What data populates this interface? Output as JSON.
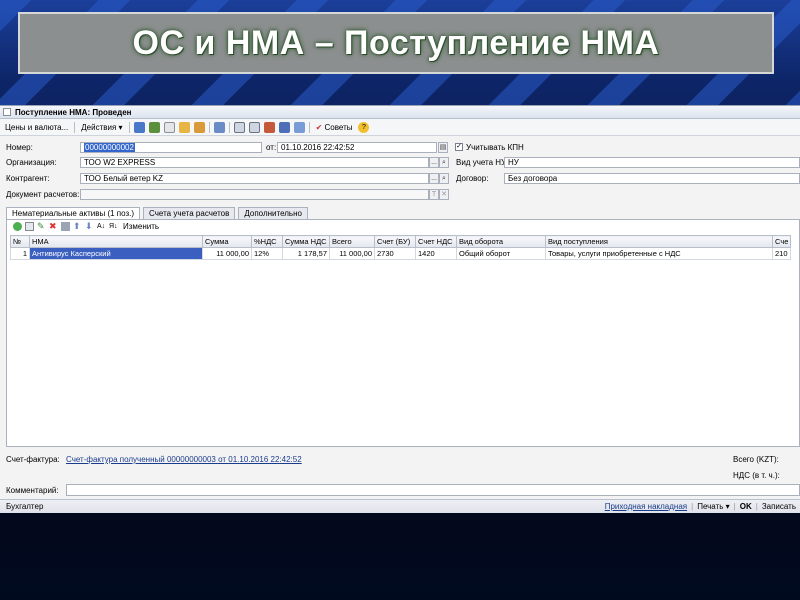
{
  "slide": {
    "title": "ОС и НМА – Поступление НМА"
  },
  "window": {
    "title": "Поступление НМА: Проведен",
    "toolbar": {
      "prices_label": "Цены и валюта...",
      "actions_label": "Действия",
      "tips_label": "Советы"
    },
    "form": {
      "number_label": "Номер:",
      "number_value": "00000000002",
      "date_label": "от:",
      "date_value": "01.10.2016 22:42:52",
      "kpn_label": "Учитывать КПН",
      "kpn_checked": true,
      "org_label": "Организация:",
      "org_value": "ТОО W2 EXPRESS",
      "nu_label": "Вид учета НУ:",
      "nu_value": "НУ",
      "contractor_label": "Контрагент:",
      "contractor_value": "ТОО Белый ветер KZ",
      "contract_label": "Договор:",
      "contract_value": "Без договора",
      "settlement_label": "Документ расчетов:",
      "settlement_value": ""
    },
    "tabs": [
      {
        "label": "Нематериальные активы (1 поз.)",
        "active": true
      },
      {
        "label": "Счета учета расчетов",
        "active": false
      },
      {
        "label": "Дополнительно",
        "active": false
      }
    ],
    "grid": {
      "change_label": "Изменить",
      "columns": [
        "№",
        "НМА",
        "Сумма",
        "%НДС",
        "Сумма НДС",
        "Всего",
        "Счет (БУ)",
        "Счет НДС",
        "Вид оборота",
        "Вид поступления",
        "Сче"
      ],
      "rows": [
        [
          "1",
          "Антивирус Касперский",
          "11 000,00",
          "12%",
          "1 178,57",
          "11 000,00",
          "2730",
          "1420",
          "Общий оборот",
          "Товары, услуги приобретенные с НДС",
          "210"
        ]
      ]
    },
    "footer": {
      "invoice_label": "Счет-фактура:",
      "invoice_link": "Счет-фактура полученный 00000000003 от 01.10.2016 22:42:52",
      "total_label": "Всего (KZT):",
      "vat_label": "НДС (в т. ч.):",
      "comment_label": "Комментарий:",
      "comment_value": ""
    },
    "status": {
      "user": "Бухгалтер",
      "waybill": "Приходная накладная",
      "print": "Печать",
      "ok": "OK",
      "save": "Записать"
    }
  }
}
